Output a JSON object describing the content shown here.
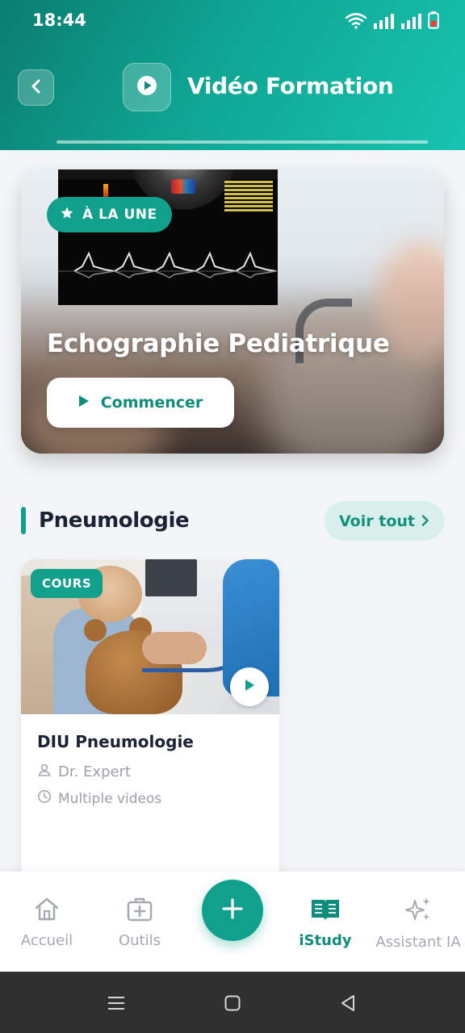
{
  "status_bar": {
    "time": "18:44",
    "icons": [
      "wifi-icon",
      "signal-icon",
      "signal-icon",
      "battery-low-icon"
    ]
  },
  "header": {
    "title": "Vidéo Formation",
    "back_icon": "chevron-left-icon",
    "title_icon": "play-circle-icon"
  },
  "featured": {
    "badge": "À LA UNE",
    "badge_icon": "star-icon",
    "title": "Echographie Pediatrique",
    "cta_label": "Commencer",
    "cta_icon": "play-icon"
  },
  "section": {
    "title": "Pneumologie",
    "see_all_label": "Voir tout",
    "see_all_icon": "chevron-right-icon"
  },
  "courses": [
    {
      "badge": "COURS",
      "title": "DIU Pneumologie",
      "author": "Dr. Expert",
      "duration": "Multiple videos",
      "author_icon": "person-icon",
      "duration_icon": "clock-icon"
    }
  ],
  "bottom_nav": {
    "items": [
      {
        "label": "Accueil",
        "icon": "home-icon",
        "active": false
      },
      {
        "label": "Outils",
        "icon": "medical-kit-icon",
        "active": false
      },
      {
        "label": "iStudy",
        "icon": "book-open-icon",
        "active": true
      },
      {
        "label": "Assistant IA",
        "icon": "sparkles-icon",
        "active": false
      }
    ],
    "fab_icon": "plus-icon"
  },
  "system_nav": [
    "menu-icon",
    "home-square-icon",
    "back-triangle-icon"
  ],
  "colors": {
    "accent": "#11a08c",
    "accent_dark": "#0f8d7c",
    "header_gradient_start": "#0b7d70",
    "header_gradient_end": "#18c4b0",
    "text_dark": "#1b2236",
    "text_muted": "#9aa1ab",
    "background": "#f3f6f8"
  }
}
